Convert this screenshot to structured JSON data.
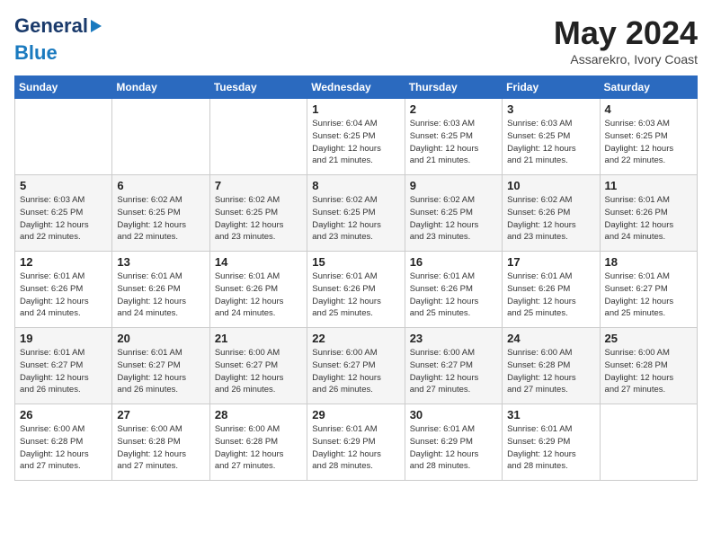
{
  "logo": {
    "line1": "General",
    "line2": "Blue"
  },
  "title": {
    "month_year": "May 2024",
    "location": "Assarekro, Ivory Coast"
  },
  "days_of_week": [
    "Sunday",
    "Monday",
    "Tuesday",
    "Wednesday",
    "Thursday",
    "Friday",
    "Saturday"
  ],
  "weeks": [
    [
      {
        "day": "",
        "info": ""
      },
      {
        "day": "",
        "info": ""
      },
      {
        "day": "",
        "info": ""
      },
      {
        "day": "1",
        "info": "Sunrise: 6:04 AM\nSunset: 6:25 PM\nDaylight: 12 hours\nand 21 minutes."
      },
      {
        "day": "2",
        "info": "Sunrise: 6:03 AM\nSunset: 6:25 PM\nDaylight: 12 hours\nand 21 minutes."
      },
      {
        "day": "3",
        "info": "Sunrise: 6:03 AM\nSunset: 6:25 PM\nDaylight: 12 hours\nand 21 minutes."
      },
      {
        "day": "4",
        "info": "Sunrise: 6:03 AM\nSunset: 6:25 PM\nDaylight: 12 hours\nand 22 minutes."
      }
    ],
    [
      {
        "day": "5",
        "info": "Sunrise: 6:03 AM\nSunset: 6:25 PM\nDaylight: 12 hours\nand 22 minutes."
      },
      {
        "day": "6",
        "info": "Sunrise: 6:02 AM\nSunset: 6:25 PM\nDaylight: 12 hours\nand 22 minutes."
      },
      {
        "day": "7",
        "info": "Sunrise: 6:02 AM\nSunset: 6:25 PM\nDaylight: 12 hours\nand 23 minutes."
      },
      {
        "day": "8",
        "info": "Sunrise: 6:02 AM\nSunset: 6:25 PM\nDaylight: 12 hours\nand 23 minutes."
      },
      {
        "day": "9",
        "info": "Sunrise: 6:02 AM\nSunset: 6:25 PM\nDaylight: 12 hours\nand 23 minutes."
      },
      {
        "day": "10",
        "info": "Sunrise: 6:02 AM\nSunset: 6:26 PM\nDaylight: 12 hours\nand 23 minutes."
      },
      {
        "day": "11",
        "info": "Sunrise: 6:01 AM\nSunset: 6:26 PM\nDaylight: 12 hours\nand 24 minutes."
      }
    ],
    [
      {
        "day": "12",
        "info": "Sunrise: 6:01 AM\nSunset: 6:26 PM\nDaylight: 12 hours\nand 24 minutes."
      },
      {
        "day": "13",
        "info": "Sunrise: 6:01 AM\nSunset: 6:26 PM\nDaylight: 12 hours\nand 24 minutes."
      },
      {
        "day": "14",
        "info": "Sunrise: 6:01 AM\nSunset: 6:26 PM\nDaylight: 12 hours\nand 24 minutes."
      },
      {
        "day": "15",
        "info": "Sunrise: 6:01 AM\nSunset: 6:26 PM\nDaylight: 12 hours\nand 25 minutes."
      },
      {
        "day": "16",
        "info": "Sunrise: 6:01 AM\nSunset: 6:26 PM\nDaylight: 12 hours\nand 25 minutes."
      },
      {
        "day": "17",
        "info": "Sunrise: 6:01 AM\nSunset: 6:26 PM\nDaylight: 12 hours\nand 25 minutes."
      },
      {
        "day": "18",
        "info": "Sunrise: 6:01 AM\nSunset: 6:27 PM\nDaylight: 12 hours\nand 25 minutes."
      }
    ],
    [
      {
        "day": "19",
        "info": "Sunrise: 6:01 AM\nSunset: 6:27 PM\nDaylight: 12 hours\nand 26 minutes."
      },
      {
        "day": "20",
        "info": "Sunrise: 6:01 AM\nSunset: 6:27 PM\nDaylight: 12 hours\nand 26 minutes."
      },
      {
        "day": "21",
        "info": "Sunrise: 6:00 AM\nSunset: 6:27 PM\nDaylight: 12 hours\nand 26 minutes."
      },
      {
        "day": "22",
        "info": "Sunrise: 6:00 AM\nSunset: 6:27 PM\nDaylight: 12 hours\nand 26 minutes."
      },
      {
        "day": "23",
        "info": "Sunrise: 6:00 AM\nSunset: 6:27 PM\nDaylight: 12 hours\nand 27 minutes."
      },
      {
        "day": "24",
        "info": "Sunrise: 6:00 AM\nSunset: 6:28 PM\nDaylight: 12 hours\nand 27 minutes."
      },
      {
        "day": "25",
        "info": "Sunrise: 6:00 AM\nSunset: 6:28 PM\nDaylight: 12 hours\nand 27 minutes."
      }
    ],
    [
      {
        "day": "26",
        "info": "Sunrise: 6:00 AM\nSunset: 6:28 PM\nDaylight: 12 hours\nand 27 minutes."
      },
      {
        "day": "27",
        "info": "Sunrise: 6:00 AM\nSunset: 6:28 PM\nDaylight: 12 hours\nand 27 minutes."
      },
      {
        "day": "28",
        "info": "Sunrise: 6:00 AM\nSunset: 6:28 PM\nDaylight: 12 hours\nand 27 minutes."
      },
      {
        "day": "29",
        "info": "Sunrise: 6:01 AM\nSunset: 6:29 PM\nDaylight: 12 hours\nand 28 minutes."
      },
      {
        "day": "30",
        "info": "Sunrise: 6:01 AM\nSunset: 6:29 PM\nDaylight: 12 hours\nand 28 minutes."
      },
      {
        "day": "31",
        "info": "Sunrise: 6:01 AM\nSunset: 6:29 PM\nDaylight: 12 hours\nand 28 minutes."
      },
      {
        "day": "",
        "info": ""
      }
    ]
  ]
}
